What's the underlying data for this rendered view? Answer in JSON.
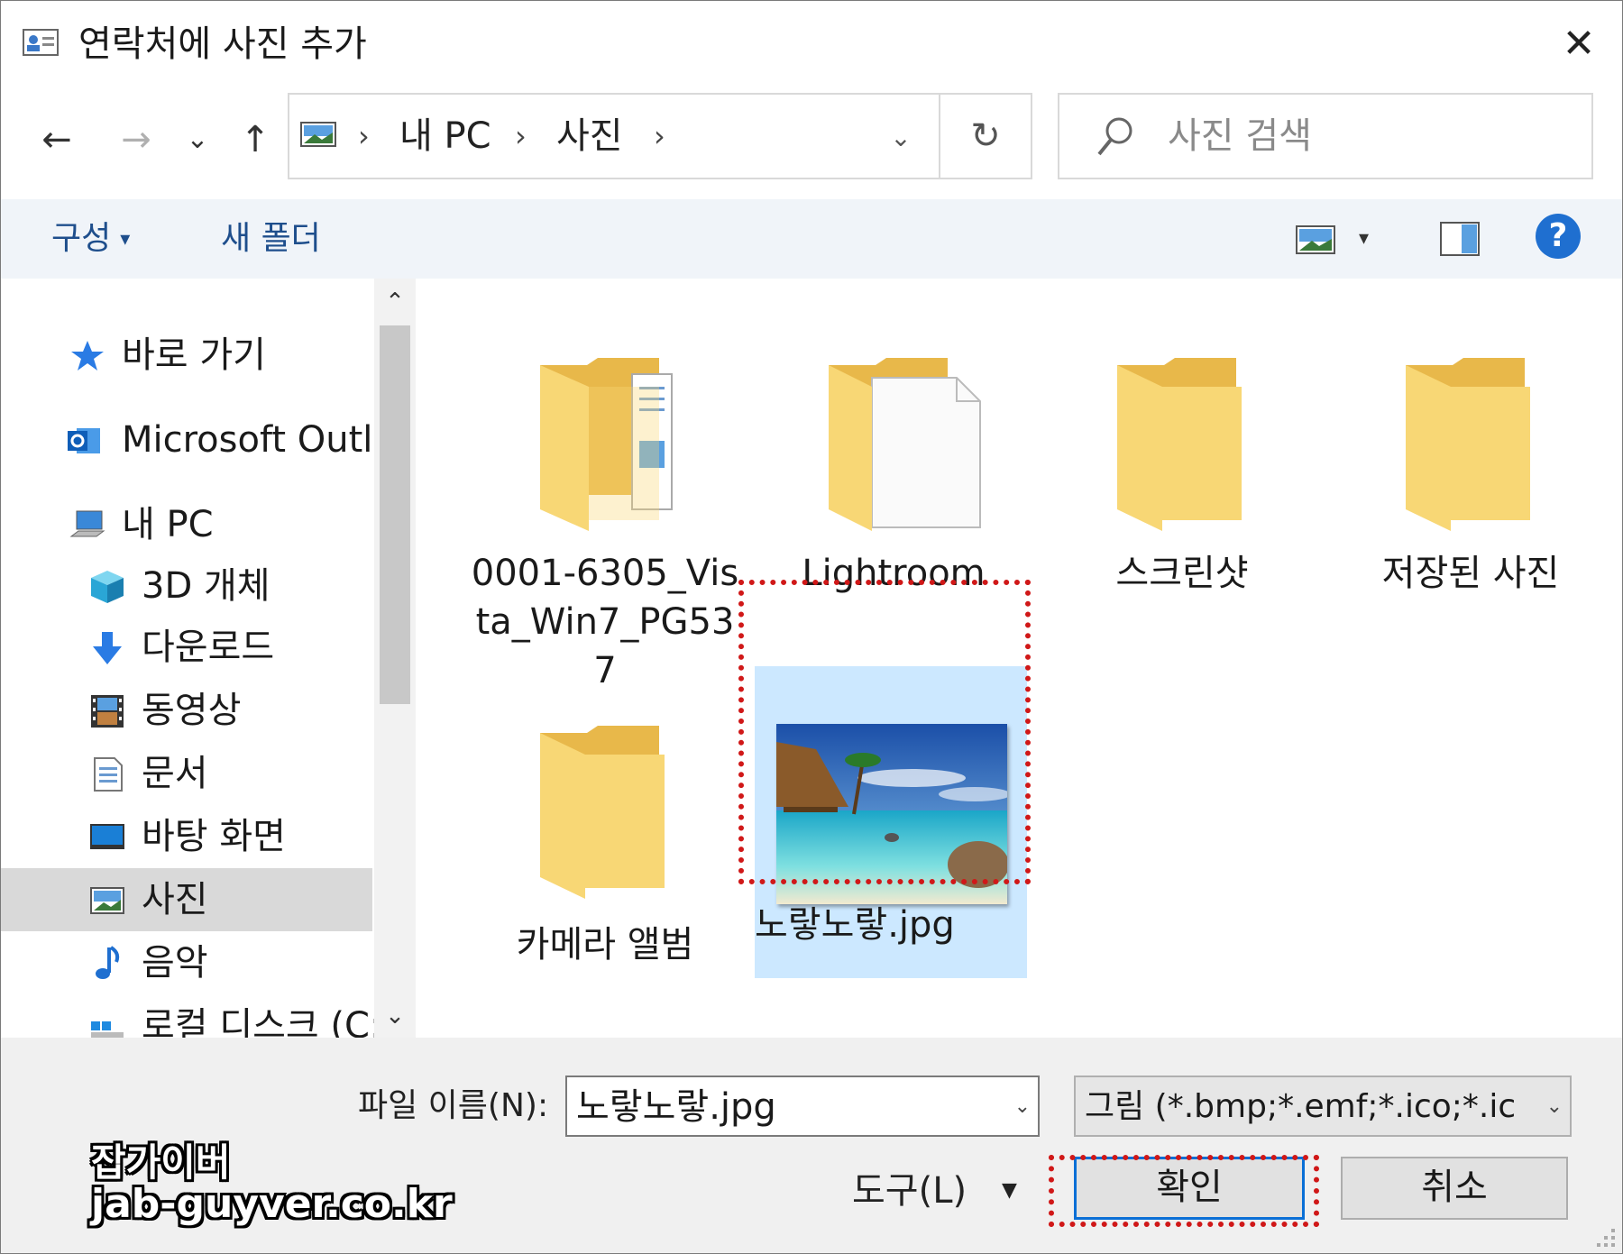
{
  "window": {
    "title": "연락처에 사진 추가",
    "close_label": "✕"
  },
  "nav": {
    "back": "←",
    "forward": "→",
    "recent": "⌄",
    "up": "↑",
    "breadcrumb": [
      "내 PC",
      "사진"
    ],
    "separator": "›",
    "address_dropdown": "⌄",
    "refresh": "↻",
    "search_placeholder": "사진 검색"
  },
  "toolbar": {
    "organize": "구성",
    "organize_caret": "▾",
    "new_folder": "새 폴더",
    "view_caret": "▾",
    "help": "?"
  },
  "sidebar": {
    "items": [
      {
        "label": "바로 가기",
        "icon": "star-icon"
      },
      {
        "label": "Microsoft Outlook",
        "icon": "outlook-icon"
      },
      {
        "label": "내 PC",
        "icon": "computer-icon"
      },
      {
        "label": "3D 개체",
        "icon": "cube-icon"
      },
      {
        "label": "다운로드",
        "icon": "download-icon"
      },
      {
        "label": "동영상",
        "icon": "video-icon"
      },
      {
        "label": "문서",
        "icon": "document-icon"
      },
      {
        "label": "바탕 화면",
        "icon": "desktop-icon"
      },
      {
        "label": "사진",
        "icon": "pictures-icon",
        "selected": true
      },
      {
        "label": "음악",
        "icon": "music-icon"
      },
      {
        "label": "로컬 디스크 (C:)",
        "icon": "drive-icon"
      }
    ],
    "scroll_up": "⌃",
    "scroll_down": "⌄"
  },
  "files": [
    {
      "name": "0001-6305_Vista_Win7_PG537",
      "icon": "folder-with-docs-icon"
    },
    {
      "name": "Lightroom",
      "icon": "folder-with-file-icon"
    },
    {
      "name": "스크린샷",
      "icon": "folder-icon"
    },
    {
      "name": "저장된 사진",
      "icon": "folder-icon"
    },
    {
      "name": "카메라 앨범",
      "icon": "folder-icon"
    },
    {
      "name": "노랗노랗.jpg",
      "icon": "beach-photo-thumbnail",
      "selected": true
    }
  ],
  "footer": {
    "filename_label": "파일 이름(N):",
    "filename_value": "노랗노랗.jpg",
    "filetype_value": "그림 (*.bmp;*.emf;*.ico;*.icon;*.j",
    "dropdown": "⌄",
    "tools_label": "도구(L)",
    "tools_caret": "▼",
    "ok_label": "확인",
    "cancel_label": "취소"
  },
  "watermark": {
    "line1": "잡가이버",
    "line2": "jab-guyver.co.kr"
  },
  "colors": {
    "accent": "#1f6fd0",
    "selection": "#cce8ff",
    "highlight_dots": "#d01818",
    "folder": "#f8d775"
  }
}
